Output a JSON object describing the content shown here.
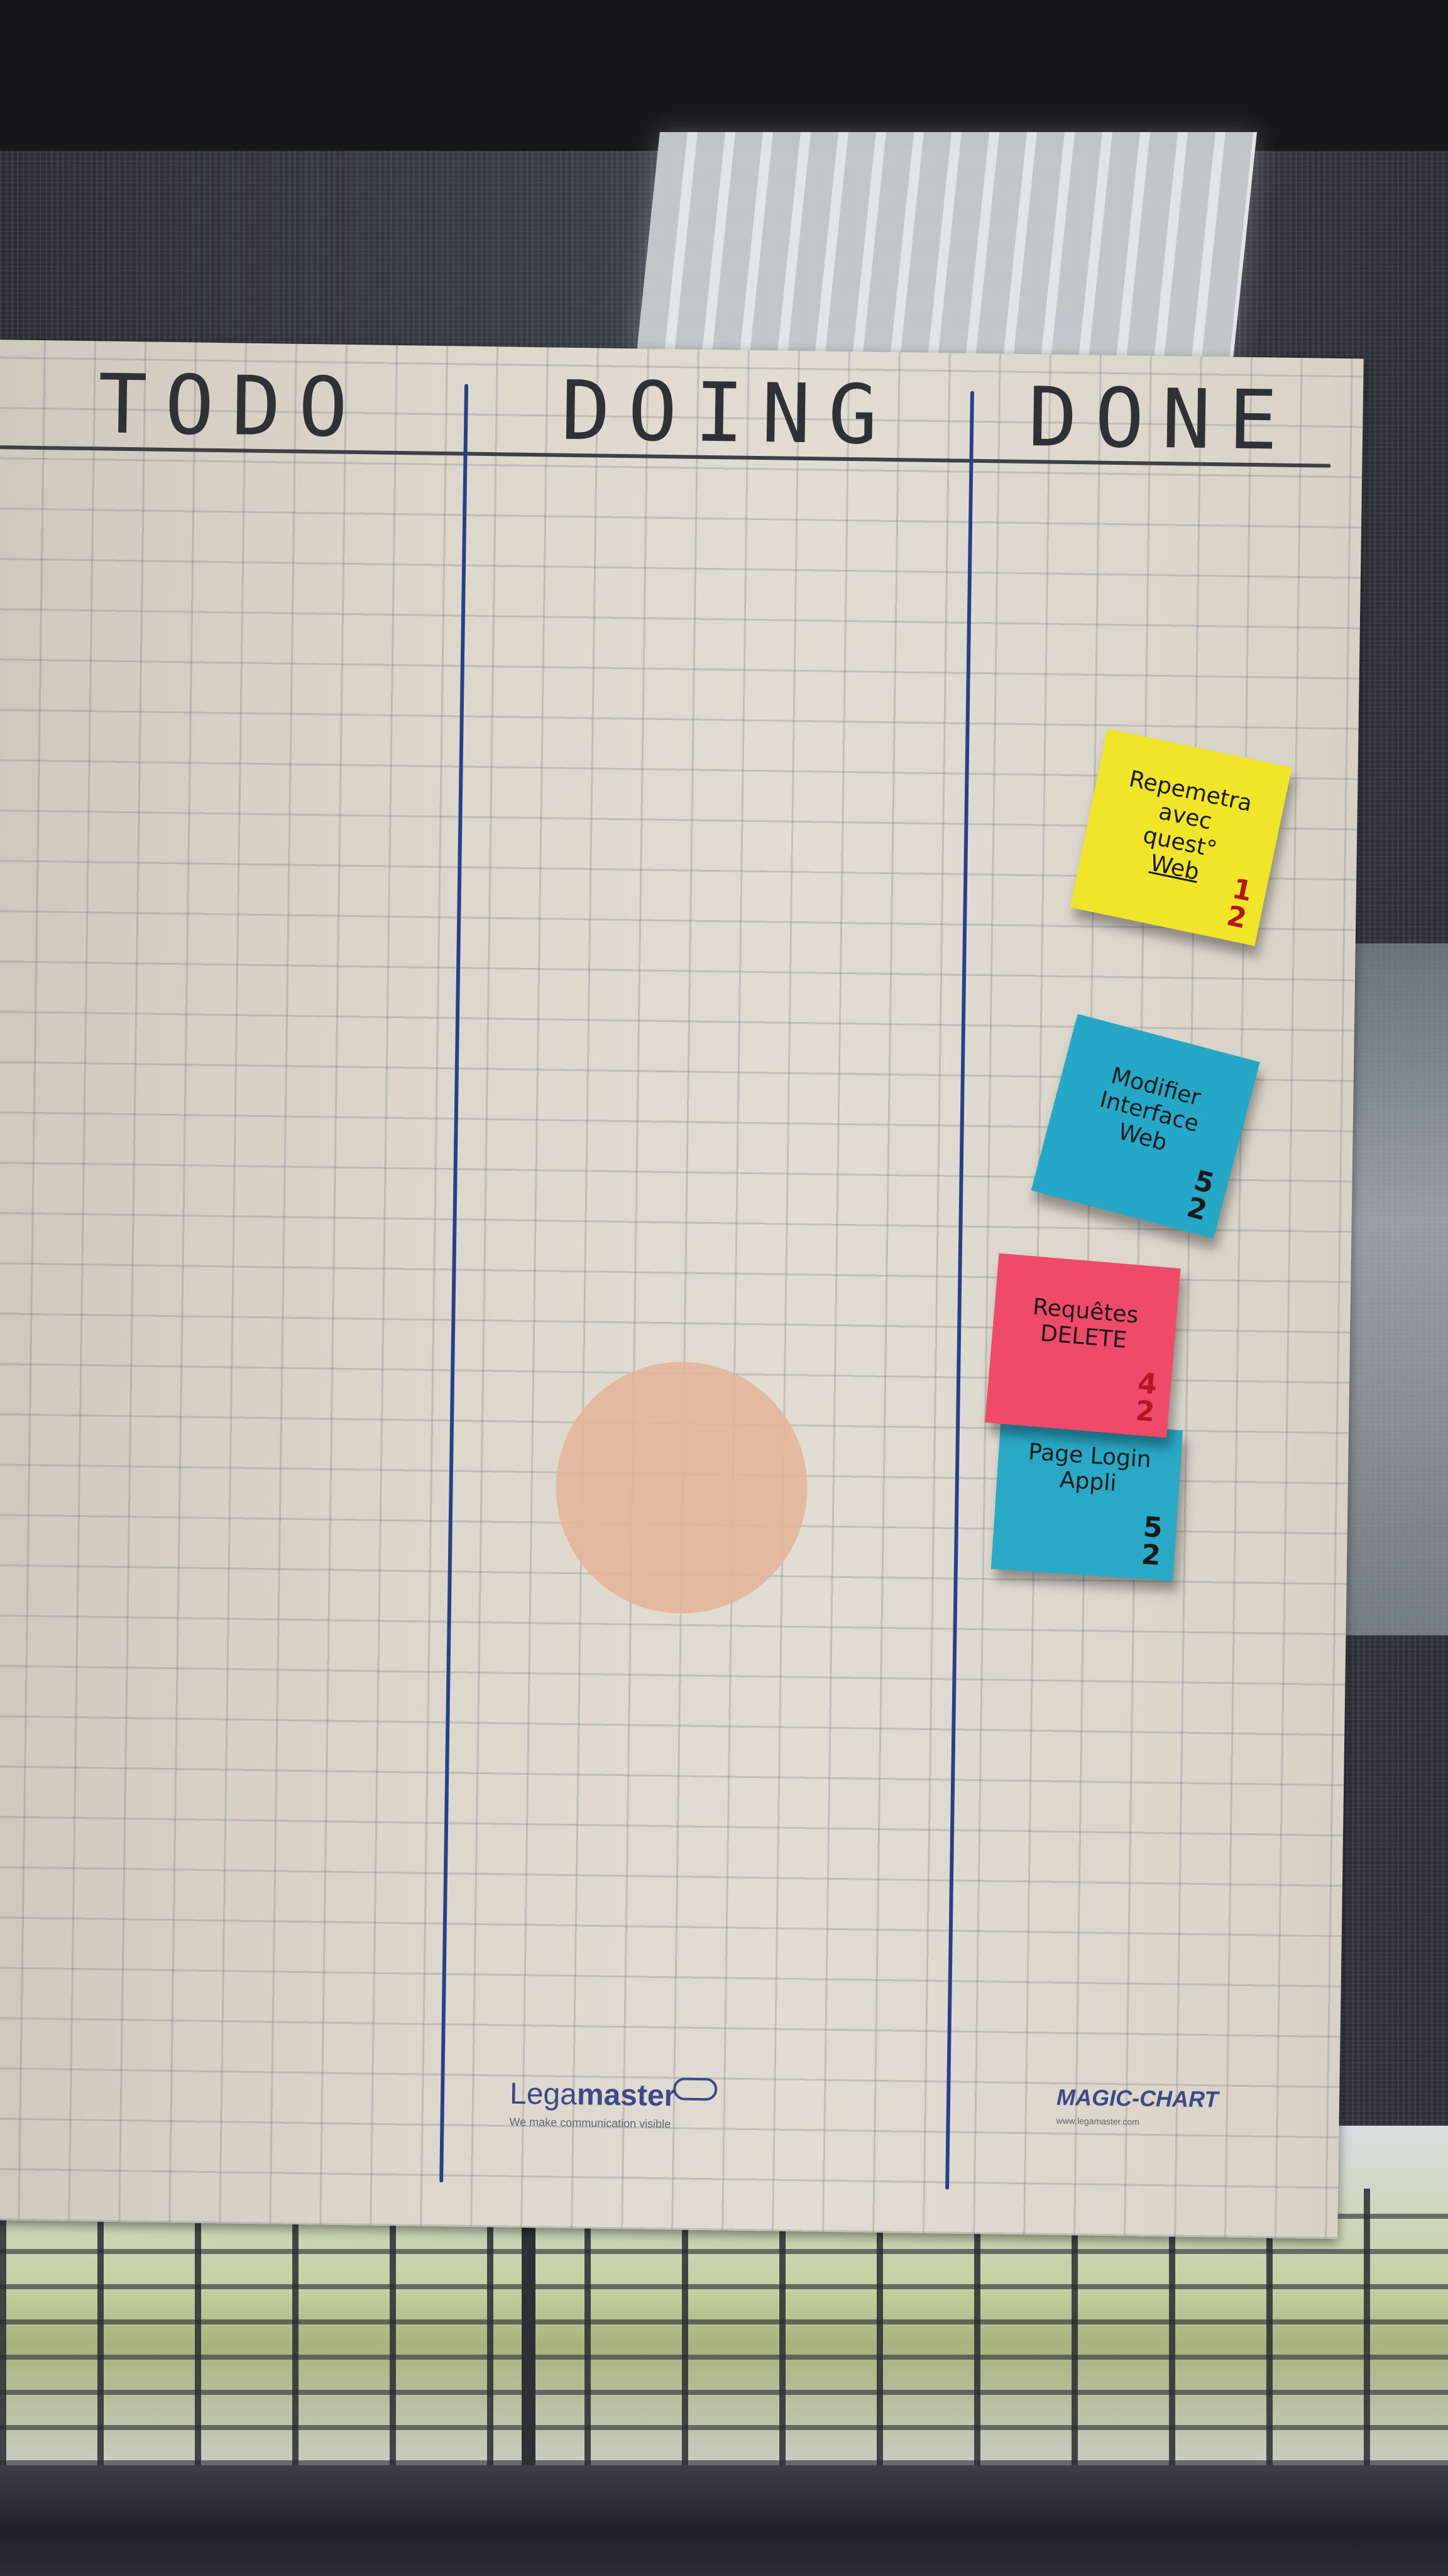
{
  "board": {
    "columns": [
      {
        "header": "TODO"
      },
      {
        "header": "DOING"
      },
      {
        "header": "DONE"
      }
    ]
  },
  "notes": [
    {
      "color": "#f1e52a",
      "lines": [
        "Repemetra",
        "avec",
        "quest°",
        "Web"
      ],
      "estimate_top": "1",
      "estimate_bottom": "2"
    },
    {
      "color": "#25a7c7",
      "lines": [
        "Modifier",
        "Interface",
        "Web"
      ],
      "estimate_top": "5",
      "estimate_bottom": "2"
    },
    {
      "color": "#ef4a6a",
      "lines": [
        "Requêtes",
        "DELETE"
      ],
      "estimate_top": "4",
      "estimate_bottom": "2"
    },
    {
      "color": "#29a9c6",
      "lines": [
        "Page Login",
        "Appli"
      ],
      "estimate_top": "5",
      "estimate_bottom": "2"
    }
  ],
  "branding": {
    "legamaster_prefix": "Lega",
    "legamaster_bold": "master",
    "tagline": "We make communication visible",
    "magic_chart": "MAGIC-CHART",
    "url": "www.legamaster.com"
  }
}
